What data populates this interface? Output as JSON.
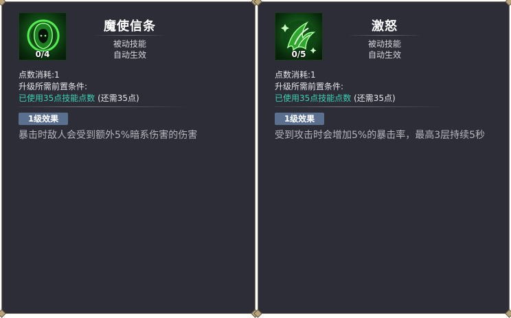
{
  "skills": [
    {
      "title": "魔使信条",
      "level": "0/4",
      "icon": "hooded-figure-icon",
      "type": "被动技能",
      "effect_mode": "自动生效",
      "cost": "点数消耗:1",
      "prereq_label": "升级所需前置条件:",
      "prereq_status": "已使用35点技能点数",
      "prereq_remaining": "(还需35点)",
      "level_badge": "1级效果",
      "level_desc": "暴击时敌人会受到额外5%暗系伤害的伤害"
    },
    {
      "title": "激怒",
      "level": "0/5",
      "icon": "enraged-claw-icon",
      "type": "被动技能",
      "effect_mode": "自动生效",
      "cost": "点数消耗:1",
      "prereq_label": "升级所需前置条件:",
      "prereq_status": "已使用35点技能点数",
      "prereq_remaining": "(还需35点)",
      "level_badge": "1级效果",
      "level_desc": "受到攻击时会增加5%的暴击率，最高3层持续5秒"
    }
  ],
  "colors": {
    "panel_bg": "#2c2d37",
    "panel_border": "#857a63",
    "prereq_met": "#3fd0b5",
    "badge_bg": "#5b6f8e",
    "icon_glow": "#6dff6a"
  }
}
